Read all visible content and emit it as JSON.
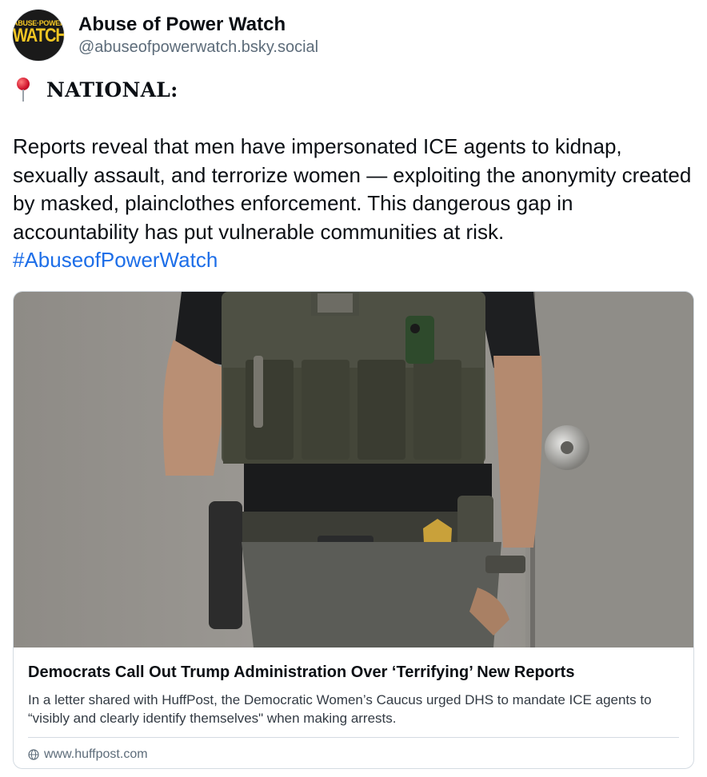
{
  "author": {
    "display_name": "Abuse of Power Watch",
    "handle": "@abuseofpowerwatch.bsky.social",
    "avatar_logo_top": "ABUSE·POWER",
    "avatar_logo_main": "WATCH"
  },
  "post": {
    "heading_icon": "round-pushpin-icon",
    "heading": "NATIONAL:",
    "body_text": "Reports reveal that men have impersonated ICE agents to kidnap, sexually assault, and terrorize women — exploiting the anonymity created by masked, plainclothes enforcement. This dangerous gap in accountability has put vulnerable communities at risk. ",
    "hashtag": "#AbuseofPowerWatch"
  },
  "link_card": {
    "image_alt": "Armed agent in tactical vest with badge on belt standing by a door",
    "title": "Democrats Call Out Trump Administration Over ‘Terrifying’ New Reports",
    "description": "In a letter shared with HuffPost, the Democratic Women’s Caucus urged DHS to mandate ICE agents to “visibly and clearly identify themselves\" when making arrests.",
    "domain_icon": "globe-icon",
    "domain": "www.huffpost.com"
  },
  "colors": {
    "link": "#1d6ee8",
    "muted_text": "#5d6c7a",
    "border": "#d4dbe2",
    "logo_yellow": "#f3c623"
  }
}
